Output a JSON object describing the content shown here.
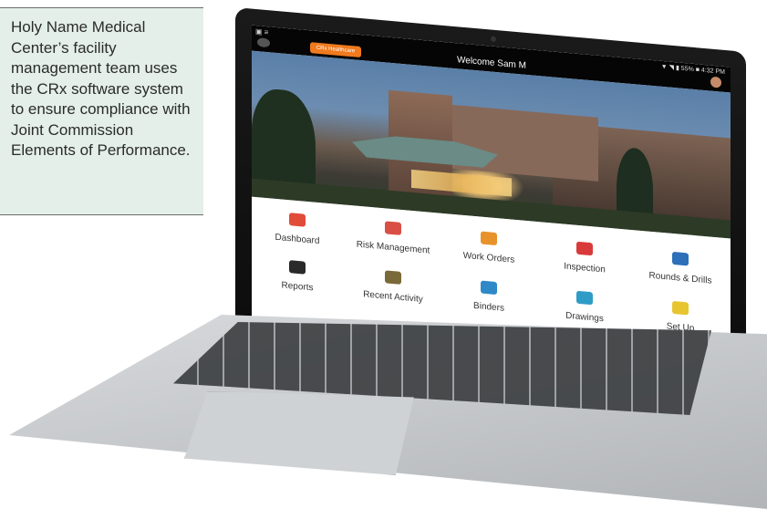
{
  "caption": {
    "text": "Holy Name Medical Center’s facility management team uses the CRx software system to ensure compliance with Joint Commission Elements of Performance."
  },
  "app": {
    "status": "▼ ◥ ▮ 55% ■ 4:32 PM",
    "pill_label": "CRx Healthcare",
    "welcome": "Welcome Sam M"
  },
  "tiles": [
    {
      "label": "Dashboard",
      "icon": "dashboard-icon",
      "color": "#e14b3a"
    },
    {
      "label": "Risk Management",
      "icon": "risk-icon",
      "color": "#d94f44"
    },
    {
      "label": "Work Orders",
      "icon": "work-orders-icon",
      "color": "#e8932a"
    },
    {
      "label": "Inspection",
      "icon": "inspection-icon",
      "color": "#d93a3a"
    },
    {
      "label": "Rounds & Drills",
      "icon": "rounds-icon",
      "color": "#2d6fb8"
    },
    {
      "label": "Reports",
      "icon": "reports-icon",
      "color": "#2a2a2a"
    },
    {
      "label": "Recent Activity",
      "icon": "recent-icon",
      "color": "#7a6a3a"
    },
    {
      "label": "Binders",
      "icon": "binders-icon",
      "color": "#2f88c7"
    },
    {
      "label": "Drawings",
      "icon": "drawings-icon",
      "color": "#2f9cc7"
    },
    {
      "label": "Set Up",
      "icon": "setup-icon",
      "color": "#e7c531"
    }
  ]
}
